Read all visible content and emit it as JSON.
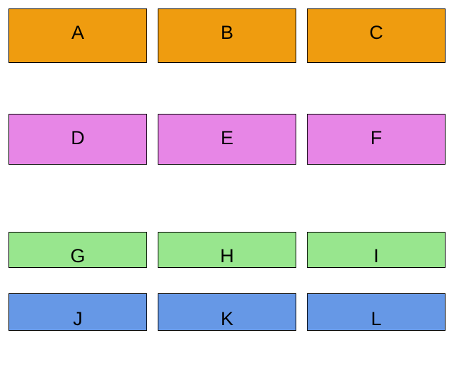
{
  "grid": {
    "rows": [
      {
        "color": "#ef9c0f",
        "cells": [
          "A",
          "B",
          "C"
        ]
      },
      {
        "color": "#e786e6",
        "cells": [
          "D",
          "E",
          "F"
        ]
      },
      {
        "color": "#98e68e",
        "cells": [
          "G",
          "H",
          "I"
        ]
      },
      {
        "color": "#6698e6",
        "cells": [
          "J",
          "K",
          "L"
        ]
      }
    ]
  }
}
